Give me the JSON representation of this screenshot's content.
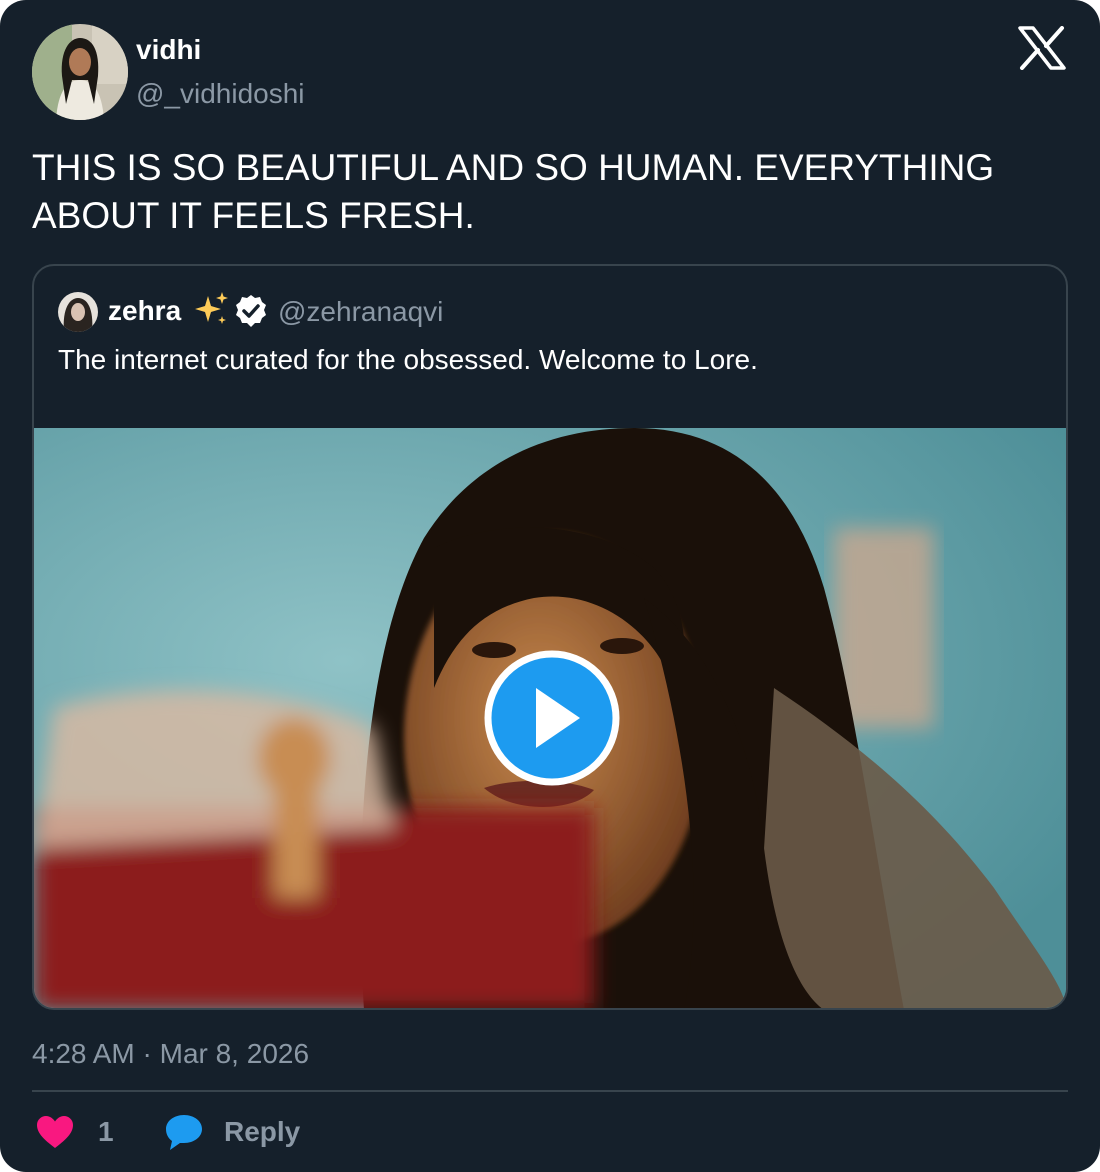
{
  "colors": {
    "background": "#15202b",
    "text": "#ffffff",
    "secondary": "#8b98a5",
    "border": "#38444d",
    "like": "#f91880",
    "reply": "#1d9bf0",
    "play": "#1d9bf0"
  },
  "tweet": {
    "author_name": "vidhi",
    "author_handle": "@_vidhidoshi",
    "text": "THIS IS SO BEAUTIFUL AND SO HUMAN. EVERYTHING ABOUT IT FEELS FRESH.",
    "timestamp": "4:28 AM · Mar 8, 2026",
    "like_count": "1",
    "reply_label": "Reply"
  },
  "quoted": {
    "author_name": "zehra",
    "author_handle": "@zehranaqvi",
    "text": "The internet curated for the obsessed. Welcome to Lore."
  },
  "icons": {
    "brand": "x-logo-icon",
    "sparkle": "sparkles-icon",
    "verified": "verified-badge-icon",
    "play": "play-icon",
    "like": "heart-icon",
    "reply": "speech-bubble-icon"
  }
}
